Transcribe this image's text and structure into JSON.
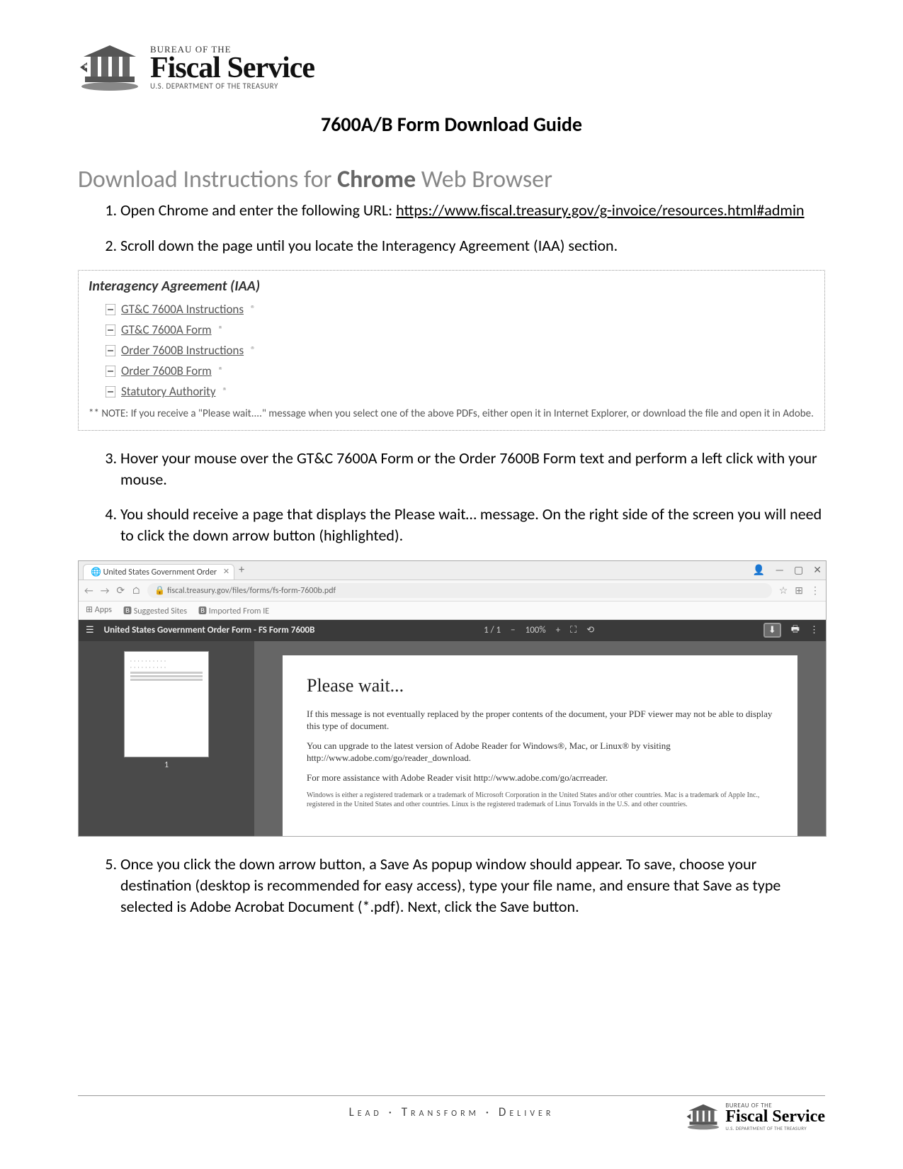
{
  "logo": {
    "top": "BUREAU OF THE",
    "main": "Fiscal Service",
    "sub": "U.S. DEPARTMENT OF THE TREASURY"
  },
  "doc_title": "7600A/B Form Download Guide",
  "section_title_pre": "Download Instructions for ",
  "section_title_bold": "Chrome",
  "section_title_post": " Web Browser",
  "step1_a": "Open Chrome and enter the following URL: ",
  "step1_link": "https://www.fiscal.treasury.gov/g-invoice/resources.html#admin",
  "step2": "Scroll down the page until you locate the Interagency Agreement (IAA) section.",
  "iaa": {
    "title": "Interagency Agreement (IAA)",
    "items": [
      "GT&C 7600A Instructions",
      "GT&C 7600A Form",
      "Order 7600B Instructions",
      "Order 7600B Form",
      "Statutory Authority"
    ],
    "ext": "®",
    "note": "** NOTE: If you receive a \"Please wait....\" message when you select one of the above PDFs, either open it in Internet Explorer, or download the file and open it in Adobe."
  },
  "step3": "Hover your mouse over the GT&C 7600A Form or the Order 7600B Form text and perform a left click with your mouse.",
  "step4": "You should receive a page that displays the Please wait… message. On the right side of the screen you will need to click the down arrow button (highlighted).",
  "browser": {
    "tab": "United States Government Order",
    "url": "fiscal.treasury.gov/files/forms/fs-form-7600b.pdf",
    "bm1": "Apps",
    "bm2": "Suggested Sites",
    "bm3": "Imported From IE",
    "pdf_title": "United States Government Order Form - FS Form 7600B",
    "page_ind": "1 / 1",
    "zoom": "100%",
    "thumb_num": "1",
    "wait_h": "Please wait...",
    "wait_p1": "If this message is not eventually replaced by the proper contents of the document, your PDF viewer may not be able to display this type of document.",
    "wait_p2": "You can upgrade to the latest version of Adobe Reader for Windows®, Mac, or Linux® by visiting http://www.adobe.com/go/reader_download.",
    "wait_p3": "For more assistance with Adobe Reader visit http://www.adobe.com/go/acrreader.",
    "wait_p4": "Windows is either a registered trademark or a trademark of Microsoft Corporation in the United States and/or other countries. Mac is a trademark of Apple Inc., registered in the United States and other countries. Linux is the registered trademark of Linus Torvalds in the U.S. and other countries."
  },
  "step5": "Once you click the down arrow button, a Save As popup window should appear. To save, choose your destination (desktop is recommended for easy access), type your file name, and ensure that Save as type selected is Adobe Acrobat Document (*.pdf). Next, click the Save button.",
  "footer": {
    "tagline": "Lead  ·  Transform  ·  Deliver",
    "top": "BUREAU OF THE",
    "main": "Fiscal Service",
    "sub": "U.S. DEPARTMENT OF THE TREASURY"
  }
}
